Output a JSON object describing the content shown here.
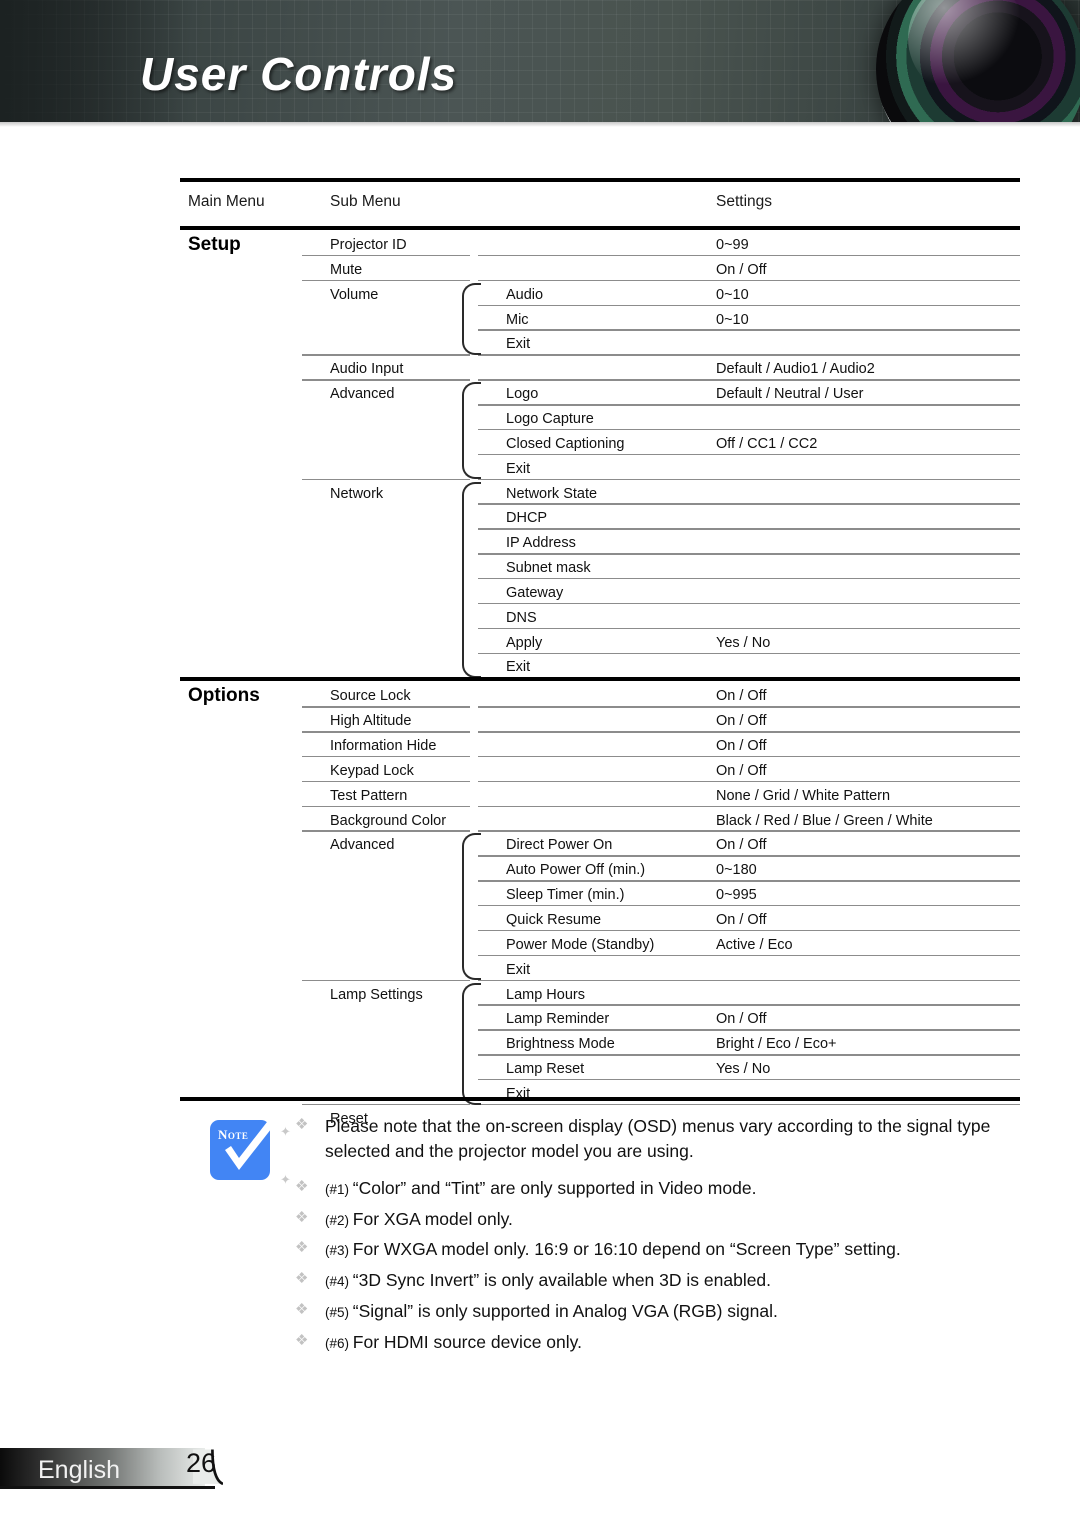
{
  "header": {
    "title": "User Controls"
  },
  "table": {
    "columns": {
      "main": "Main Menu",
      "sub": "Sub Menu",
      "settings": "Settings"
    },
    "groups": [
      {
        "main": "Setup",
        "rows": [
          {
            "sub": "Projector ID",
            "child": "",
            "settings": "0~99"
          },
          {
            "sub": "Mute",
            "child": "",
            "settings": "On / Off"
          },
          {
            "sub": "Volume",
            "child": "Audio",
            "settings": "0~10"
          },
          {
            "sub": "",
            "child": "Mic",
            "settings": "0~10"
          },
          {
            "sub": "",
            "child": "Exit",
            "settings": ""
          },
          {
            "sub": "Audio Input",
            "child": "",
            "settings": "Default / Audio1 / Audio2"
          },
          {
            "sub": "Advanced",
            "child": "Logo",
            "settings": "Default / Neutral / User"
          },
          {
            "sub": "",
            "child": "Logo Capture",
            "settings": ""
          },
          {
            "sub": "",
            "child": "Closed Captioning",
            "settings": "Off / CC1 / CC2"
          },
          {
            "sub": "",
            "child": "Exit",
            "settings": ""
          },
          {
            "sub": "Network",
            "child": "Network State",
            "settings": ""
          },
          {
            "sub": "",
            "child": "DHCP",
            "settings": ""
          },
          {
            "sub": "",
            "child": "IP Address",
            "settings": ""
          },
          {
            "sub": "",
            "child": "Subnet mask",
            "settings": ""
          },
          {
            "sub": "",
            "child": "Gateway",
            "settings": ""
          },
          {
            "sub": "",
            "child": "DNS",
            "settings": ""
          },
          {
            "sub": "",
            "child": "Apply",
            "settings": "Yes / No"
          },
          {
            "sub": "",
            "child": "Exit",
            "settings": ""
          }
        ]
      },
      {
        "main": "Options",
        "rows": [
          {
            "sub": "Source Lock",
            "child": "",
            "settings": "On / Off"
          },
          {
            "sub": "High Altitude",
            "child": "",
            "settings": "On / Off"
          },
          {
            "sub": "Information Hide",
            "child": "",
            "settings": "On / Off"
          },
          {
            "sub": "Keypad Lock",
            "child": "",
            "settings": "On / Off"
          },
          {
            "sub": "Test Pattern",
            "child": "",
            "settings": "None / Grid / White Pattern"
          },
          {
            "sub": "Background Color",
            "child": "",
            "settings": "Black / Red / Blue / Green / White"
          },
          {
            "sub": "Advanced",
            "child": "Direct Power On",
            "settings": "On / Off"
          },
          {
            "sub": "",
            "child": "Auto Power Off (min.)",
            "settings": "0~180"
          },
          {
            "sub": "",
            "child": "Sleep Timer (min.)",
            "settings": "0~995"
          },
          {
            "sub": "",
            "child": "Quick Resume",
            "settings": "On / Off"
          },
          {
            "sub": "",
            "child": "Power Mode (Standby)",
            "settings": "Active / Eco"
          },
          {
            "sub": "",
            "child": "Exit",
            "settings": ""
          },
          {
            "sub": "Lamp Settings",
            "child": "Lamp Hours",
            "settings": ""
          },
          {
            "sub": "",
            "child": "Lamp Reminder",
            "settings": "On / Off"
          },
          {
            "sub": "",
            "child": "Brightness Mode",
            "settings": "Bright / Eco / Eco+"
          },
          {
            "sub": "",
            "child": "Lamp Reset",
            "settings": "Yes / No"
          },
          {
            "sub": "",
            "child": "Exit",
            "settings": ""
          },
          {
            "sub": "Reset",
            "child": "",
            "settings": ""
          }
        ]
      }
    ]
  },
  "notes": {
    "icon_label": "Note",
    "items": [
      {
        "num": "",
        "text": "Please note that the on-screen display (OSD) menus vary according to the signal type selected and the projector model you are using."
      },
      {
        "num": "(#1)",
        "text": "“Color” and “Tint” are only supported in Video mode."
      },
      {
        "num": "(#2)",
        "text": "For XGA model only."
      },
      {
        "num": "(#3)",
        "text": "For WXGA model only. 16:9 or 16:10 depend on “Screen Type” setting."
      },
      {
        "num": "(#4)",
        "text": "“3D Sync Invert” is only available when 3D is enabled."
      },
      {
        "num": "(#5)",
        "text": "“Signal” is only supported in Analog VGA (RGB) signal."
      },
      {
        "num": "(#6)",
        "text": "For HDMI source device only."
      }
    ]
  },
  "footer": {
    "language": "English",
    "page": "26"
  },
  "colors": {
    "note_blue": "#4285F4",
    "rule": "#8c8c8c",
    "bar": "#000000"
  }
}
